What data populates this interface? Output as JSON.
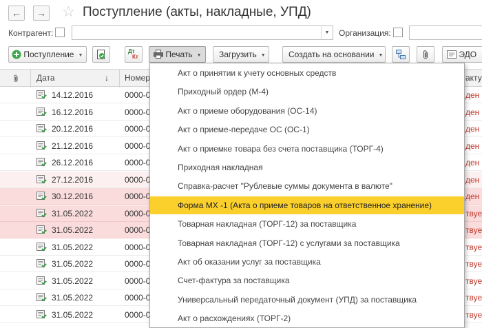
{
  "header": {
    "back_icon": "arrow-left-icon",
    "back_glyph": "←",
    "forward_icon": "arrow-right-icon",
    "forward_glyph": "→",
    "favorite_icon": "star-icon",
    "star_glyph": "☆",
    "title": "Поступление (акты, накладные, УПД)"
  },
  "filters": {
    "counterparty_label": "Контрагент:",
    "counterparty_value": "",
    "organization_label": "Организация:",
    "organization_value": "",
    "dropdown_glyph": "▼"
  },
  "toolbar": {
    "receipt_label": "Поступление",
    "copy_icon": "copy-document-icon",
    "dt_kt_icon": "dt-kt-postings-icon",
    "dt_text": "Дт",
    "kt_text": "Кт",
    "print_label": "Печать",
    "load_label": "Загрузить",
    "create_based_label": "Создать на основании",
    "structure_icon": "document-structure-icon",
    "attach_icon": "paperclip-icon",
    "edo_label": "ЭДО",
    "caret_glyph": "▼"
  },
  "table": {
    "columns": {
      "attachment_icon": "paperclip-icon",
      "date": "Дата",
      "sort_glyph": "↓",
      "number": "Номер",
      "status_partial": "актуры"
    },
    "rows": [
      {
        "date": "14.12.2016",
        "number": "0000-0",
        "status": "ден",
        "highlight": "none"
      },
      {
        "date": "16.12.2016",
        "number": "0000-0",
        "status": "ден",
        "highlight": "none"
      },
      {
        "date": "20.12.2016",
        "number": "0000-0",
        "status": "ден",
        "highlight": "none"
      },
      {
        "date": "21.12.2016",
        "number": "0000-0",
        "status": "ден",
        "highlight": "none"
      },
      {
        "date": "26.12.2016",
        "number": "0000-0",
        "status": "ден",
        "highlight": "none"
      },
      {
        "date": "27.12.2016",
        "number": "0000-0",
        "status": "ден",
        "highlight": "light"
      },
      {
        "date": "30.12.2016",
        "number": "0000-0",
        "status": "ден",
        "highlight": "pink"
      },
      {
        "date": "31.05.2022",
        "number": "0000-0",
        "status": "твует",
        "highlight": "pink"
      },
      {
        "date": "31.05.2022",
        "number": "0000-0",
        "status": "твует",
        "highlight": "pink"
      },
      {
        "date": "31.05.2022",
        "number": "0000-0",
        "status": "твует",
        "highlight": "none"
      },
      {
        "date": "31.05.2022",
        "number": "0000-0",
        "status": "твует",
        "highlight": "none"
      },
      {
        "date": "31.05.2022",
        "number": "0000-0",
        "status": "твует",
        "highlight": "none"
      },
      {
        "date": "31.05.2022",
        "number": "0000-0",
        "status": "твует",
        "highlight": "none"
      },
      {
        "date": "31.05.2022",
        "number": "0000-0",
        "status": "твует",
        "highlight": "none"
      }
    ]
  },
  "print_menu": {
    "items": [
      {
        "label": "Акт о принятии к учету основных средств"
      },
      {
        "label": "Приходный ордер (М-4)"
      },
      {
        "label": "Акт о приеме оборудования (ОС-14)"
      },
      {
        "label": "Акт о приеме-передаче ОС (ОС-1)"
      },
      {
        "label": "Акт о приемке товара без счета поставщика (ТОРГ-4)"
      },
      {
        "label": "Приходная накладная"
      },
      {
        "label": "Справка-расчет \"Рублевые суммы документа в валюте\""
      },
      {
        "label": "Форма МХ -1 (Акта о приеме товаров на ответственное  хранение)",
        "highlighted": true
      },
      {
        "label": "Товарная накладная (ТОРГ-12) за поставщика"
      },
      {
        "label": "Товарная накладная (ТОРГ-12) с услугами за поставщика"
      },
      {
        "label": "Акт об оказании услуг за поставщика"
      },
      {
        "label": "Счет-фактура за поставщика"
      },
      {
        "label": "Универсальный передаточный документ (УПД) за поставщика"
      },
      {
        "label": "Акт о расхождениях (ТОРГ-2)"
      }
    ]
  },
  "colors": {
    "highlight_yellow": "#fbd02c",
    "row_pink": "#fadcdc",
    "status_red": "#c0392b",
    "green_accent": "#3aa84b"
  }
}
